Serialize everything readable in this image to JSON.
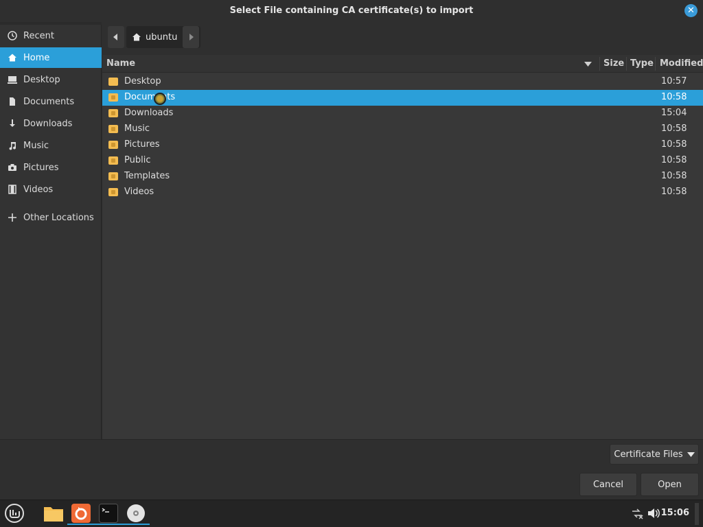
{
  "window": {
    "title": "Select File containing CA certificate(s) to import"
  },
  "sidebar": {
    "items": [
      {
        "label": "Recent",
        "icon": "clock-icon"
      },
      {
        "label": "Home",
        "icon": "home-icon",
        "active": true
      },
      {
        "label": "Desktop",
        "icon": "desktop-icon"
      },
      {
        "label": "Documents",
        "icon": "document-icon"
      },
      {
        "label": "Downloads",
        "icon": "download-icon"
      },
      {
        "label": "Music",
        "icon": "music-icon"
      },
      {
        "label": "Pictures",
        "icon": "camera-icon"
      },
      {
        "label": "Videos",
        "icon": "film-icon"
      },
      {
        "label": "Other Locations",
        "icon": "plus-icon"
      }
    ]
  },
  "pathbar": {
    "current": "ubuntu"
  },
  "filelist": {
    "columns": {
      "name": "Name",
      "size": "Size",
      "type": "Type",
      "modified": "Modified"
    },
    "rows": [
      {
        "name": "Desktop",
        "modified": "10:57"
      },
      {
        "name": "Documents",
        "modified": "10:58",
        "selected": true
      },
      {
        "name": "Downloads",
        "modified": "15:04"
      },
      {
        "name": "Music",
        "modified": "10:58"
      },
      {
        "name": "Pictures",
        "modified": "10:58"
      },
      {
        "name": "Public",
        "modified": "10:58"
      },
      {
        "name": "Templates",
        "modified": "10:58"
      },
      {
        "name": "Videos",
        "modified": "10:58"
      }
    ]
  },
  "filter": {
    "selected": "Certificate Files"
  },
  "actions": {
    "cancel": "Cancel",
    "open": "Open"
  },
  "taskbar": {
    "clock": "15:06"
  },
  "colors": {
    "accent": "#2b9fd9",
    "folder": "#f3bc51"
  }
}
